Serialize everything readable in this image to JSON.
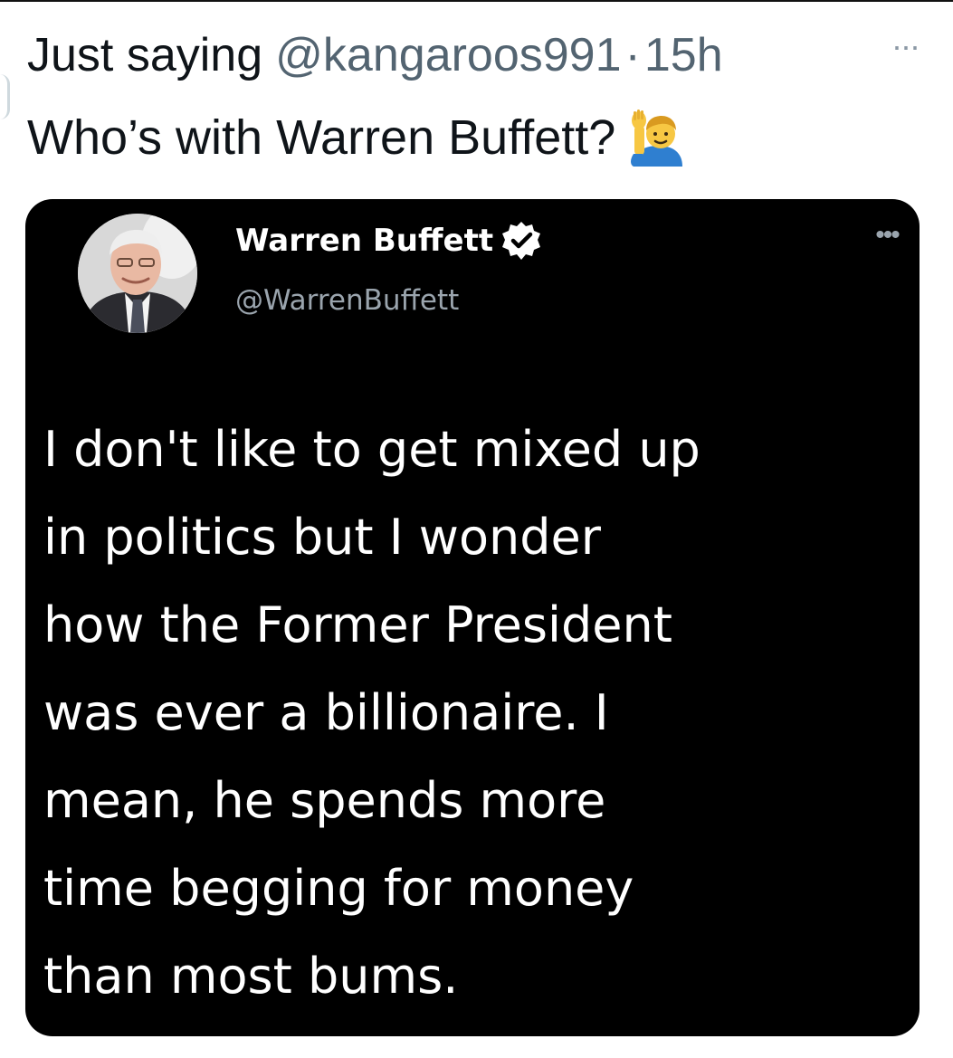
{
  "tweet": {
    "display_name": "Just saying",
    "handle": "@kangaroos991",
    "separator": "·",
    "time": "15h",
    "more_label": "···",
    "text": "Who’s with Warren Buffett?",
    "emoji_icon": "person-raising-hand-icon"
  },
  "embedded_tweet": {
    "name": "Warren Buffett",
    "verified_icon": "verified-badge-icon",
    "handle": "@WarrenBuffett",
    "more_label": "•••",
    "text_lines": [
      "I don't like to get mixed up",
      "in politics but I wonder",
      "how the Former President",
      "was ever a billionaire. I",
      "mean, he spends more",
      "time begging for money",
      "than most bums."
    ]
  },
  "colors": {
    "primary_text": "#0f1419",
    "secondary_text": "#536471",
    "embedded_background": "#000000",
    "embedded_text": "#ffffff",
    "embedded_secondary_text": "#9aa4ad"
  }
}
